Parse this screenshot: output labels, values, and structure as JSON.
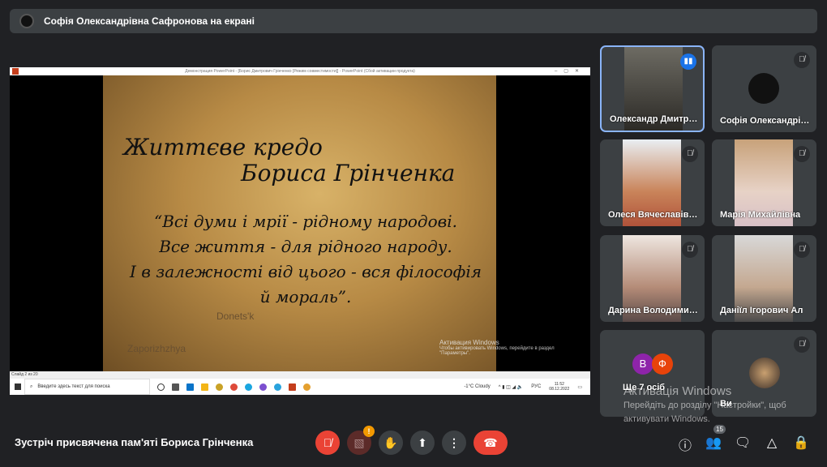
{
  "presenter_banner": "Софія Олександрівна Сафронова на екрані",
  "shared_screen": {
    "window_title": "Демонстрация PowerPoint - [Борис Дмитрович Грінченко [Режим совместимости]] - PowerPoint (Сбой активации продукта)",
    "slide": {
      "title_line1": "Життєве  кредо",
      "title_line2": "Бориса Грінченка",
      "quote": [
        "“Всі думи і мрії - рідному народові.",
        "Все життя - для рідного народу.",
        "І в залежності від цього - вся філософія",
        "й мораль”."
      ],
      "map_label1": "Donets'k",
      "map_label2": "Zaporizhzhya",
      "activation": "Активация Windows",
      "activation_sub": "Чтобы активировать Windows, перейдите в раздел \"Параметры\"."
    },
    "status_bar": "Слайд 2 из 20",
    "taskbar": {
      "search_placeholder": "Введите здесь текст для поиска",
      "weather": "-1°C  Cloudy",
      "lang": "РУС",
      "time": "11:52",
      "date": "08.12.2022"
    }
  },
  "participants": [
    {
      "name": "Олександр Дмитрович",
      "speaking": true
    },
    {
      "name": "Софія Олександрівна",
      "muted": true
    },
    {
      "name": "Олеся Вячеславівна",
      "muted": true
    },
    {
      "name": "Марія Михайлівна",
      "muted": true
    },
    {
      "name": "Дарина Володимирівна",
      "muted": true
    },
    {
      "name": "Даніїл Ігорович Ал",
      "muted": true
    }
  ],
  "more_tile": {
    "label": "Ще 7 осіб",
    "avatars": [
      {
        "letter": "В",
        "color": "#8e24aa"
      },
      {
        "letter": "Ф",
        "color": "#e8430a"
      }
    ]
  },
  "self_tile": {
    "label": "Ви"
  },
  "windows_activation": {
    "title": "Активація Windows",
    "line1": "Перейдіть до розділу \"Настройки\", щоб",
    "line2": "активувати Windows."
  },
  "meeting_title": "Зустріч присвячена пам'яті Бориса Грінченка",
  "participant_count": "15",
  "colors": {
    "bg": "#202124",
    "tile": "#3c4043",
    "end_call": "#ea4335",
    "active_border": "#8ab4f8",
    "warning": "#f29900"
  }
}
